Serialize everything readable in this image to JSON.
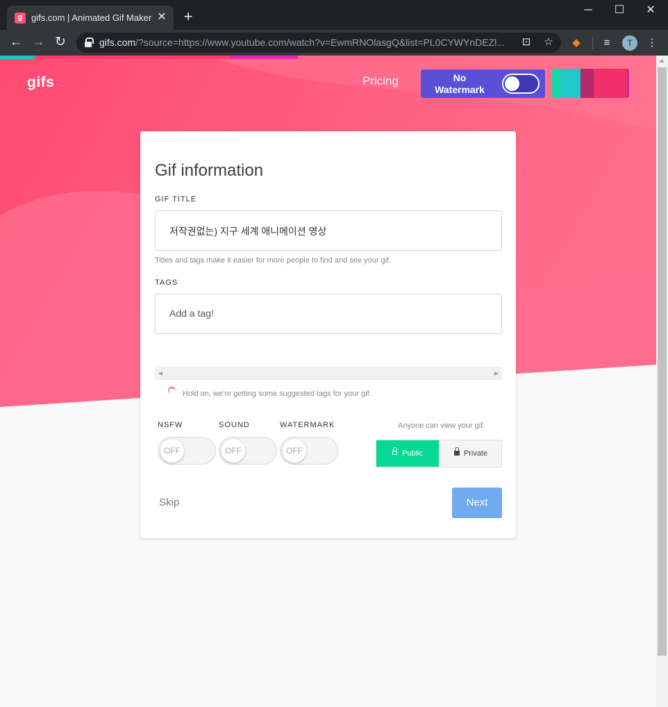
{
  "browser": {
    "tab_title": "gifs.com | Animated Gif Maker and",
    "favicon_letter": "g",
    "url_host": "gifs.com",
    "url_path": "/?source=https://www.youtube.com/watch?v=EwmRNOlasgQ&list=PL0CYWYnDEZl...",
    "profile_initial": "T"
  },
  "header": {
    "logo": "gifs",
    "pricing": "Pricing",
    "no_watermark": "No Watermark"
  },
  "form": {
    "heading": "Gif information",
    "title_label": "GIF TITLE",
    "title_value": "저작권없는) 지구 세계 애니메이션 영상",
    "hint": "Titles and tags make it easier for more people to find and see your gif.",
    "tags_label": "TAGS",
    "tags_placeholder": "Add a tag!",
    "loading": "Hold on, we're getting some suggested tags for your gif.",
    "toggles": [
      {
        "label": "NSFW",
        "state": "OFF"
      },
      {
        "label": "SOUND",
        "state": "OFF"
      },
      {
        "label": "WATERMARK",
        "state": "OFF"
      }
    ],
    "visibility_note": "Anyone can view your gif.",
    "public": "Public",
    "private": "Private",
    "skip": "Skip",
    "next": "Next"
  },
  "colors": {
    "accent_pink": "#ff4f73",
    "public_green": "#07d893",
    "next_blue": "#71aaee",
    "watermark_purple": "#5a4fd6"
  }
}
